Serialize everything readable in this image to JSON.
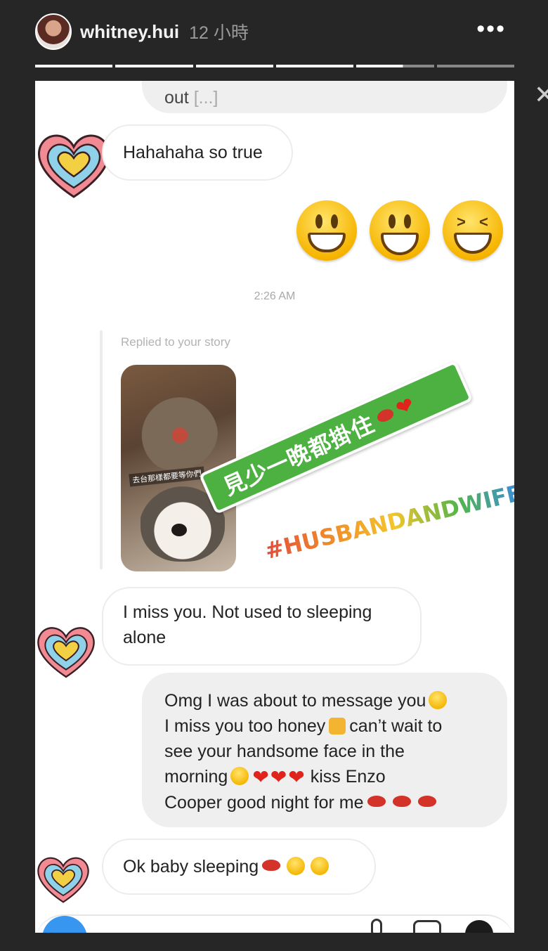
{
  "story": {
    "username": "whitney.hui",
    "time_ago": "12 小時",
    "more_label": "•••",
    "close_label": "✕",
    "progress_segments": [
      1,
      1,
      1,
      1,
      0.6,
      0
    ]
  },
  "dm": {
    "messages": {
      "out_snippet": "out",
      "out_more": "[...]",
      "hahaha": "Hahahaha so true",
      "timestamp": "2:26 AM",
      "replied_label": "Replied to your story",
      "miss": "I miss you. Not used to sleeping alone",
      "omg_l1": "Omg I was about to message you",
      "omg_l2a": "I miss you too honey",
      "omg_l2b": "can’t wait to",
      "omg_l3": "see your handsome face in the",
      "omg_l4a": "morning",
      "omg_l4b": "kiss Enzo",
      "omg_l5": "Cooper good night for me",
      "ok": "Ok baby sleeping"
    },
    "story_thumb_caption": "去台那樣都要等你們",
    "emojis": [
      "grinning-face",
      "smiley-face",
      "squinting-laughing-face"
    ]
  },
  "stickers": {
    "green_text": "見少一晚都掛住",
    "hashtag": "#HUSBANDANDWIFETOBE"
  },
  "colors": {
    "background": "#262626",
    "card": "#ffffff",
    "sent_bubble": "#efefef",
    "green_sticker": "#4db141",
    "accent_blue": "#3797f0"
  }
}
